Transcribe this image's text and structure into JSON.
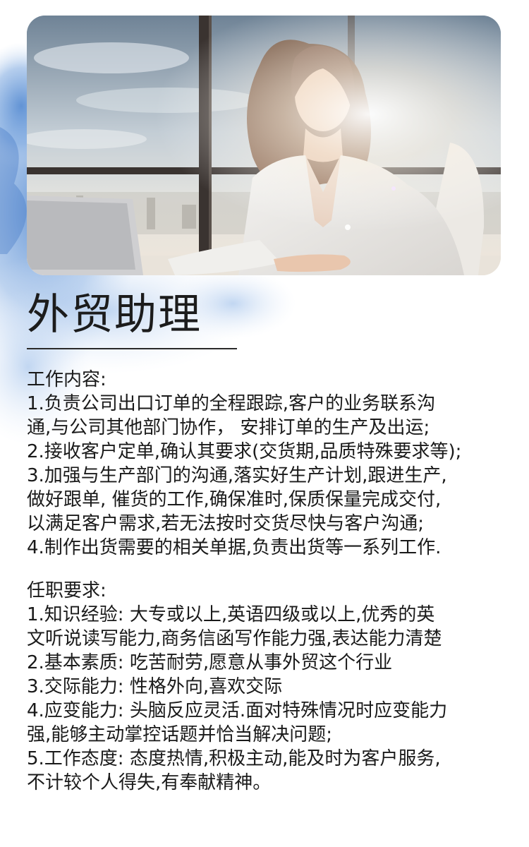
{
  "title": "外贸助理",
  "job_content": {
    "heading": "工作内容:",
    "lines": [
      "1.负责公司出口订单的全程跟踪,客户的业务联系沟",
      "通,与公司其他部门协作， 安排订单的生产及出运;",
      "2.接收客户定单,确认其要求(交货期,品质特殊要求等);",
      "3.加强与生产部门的沟通,落实好生产计划,跟进生产,",
      "做好跟单, 催货的工作,确保准时,保质保量完成交付,",
      "以满足客户需求,若无法按时交货尽快与客户沟通;",
      "4.制作出货需要的相关单据,负责出货等一系列工作."
    ]
  },
  "requirements": {
    "heading": "任职要求:",
    "lines": [
      "1.知识经验: 大专或以上,英语四级或以上,优秀的英",
      "文听说读写能力,商务信函写作能力强,表达能力清楚",
      "2.基本素质: 吃苦耐劳,愿意从事外贸这个行业",
      "3.交际能力: 性格外向,喜欢交际",
      "4.应变能力: 头脑反应灵活.面对特殊情况时应变能力",
      "强,能够主动掌控话题并恰当解决问题;",
      "5.工作态度: 态度热情,积极主动,能及时为客户服务,",
      "不计较个人得失,有奉献精神。"
    ]
  },
  "colors": {
    "accent_blue": "#5a8fd0",
    "text": "#1a1a1a"
  },
  "icons": {
    "hero": "office-woman-photo"
  }
}
